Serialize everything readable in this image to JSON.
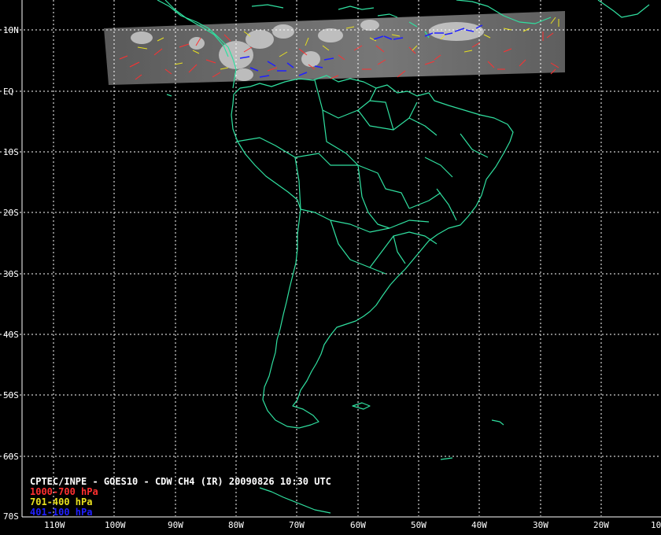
{
  "caption": {
    "title": "CPTEC/INPE - GOES10 - CDW CH4 (IR) 20090826 10:30 UTC",
    "legend": [
      {
        "label": "1000-700 hPa",
        "color": "#ff3030"
      },
      {
        "label": "701-400 hPa",
        "color": "#e8e020"
      },
      {
        "label": "401-100 hPa",
        "color": "#2020ff"
      }
    ]
  },
  "lat_labels": [
    "10N",
    "EQ",
    "10S",
    "20S",
    "30S",
    "40S",
    "50S",
    "60S",
    "70S"
  ],
  "lon_labels": [
    "110W",
    "100W",
    "90W",
    "80W",
    "70W",
    "60W",
    "50W",
    "40W",
    "30W",
    "20W",
    "10"
  ],
  "colors": {
    "coast": "#30e0a0",
    "grid": "#ffffff",
    "background": "#000000"
  }
}
